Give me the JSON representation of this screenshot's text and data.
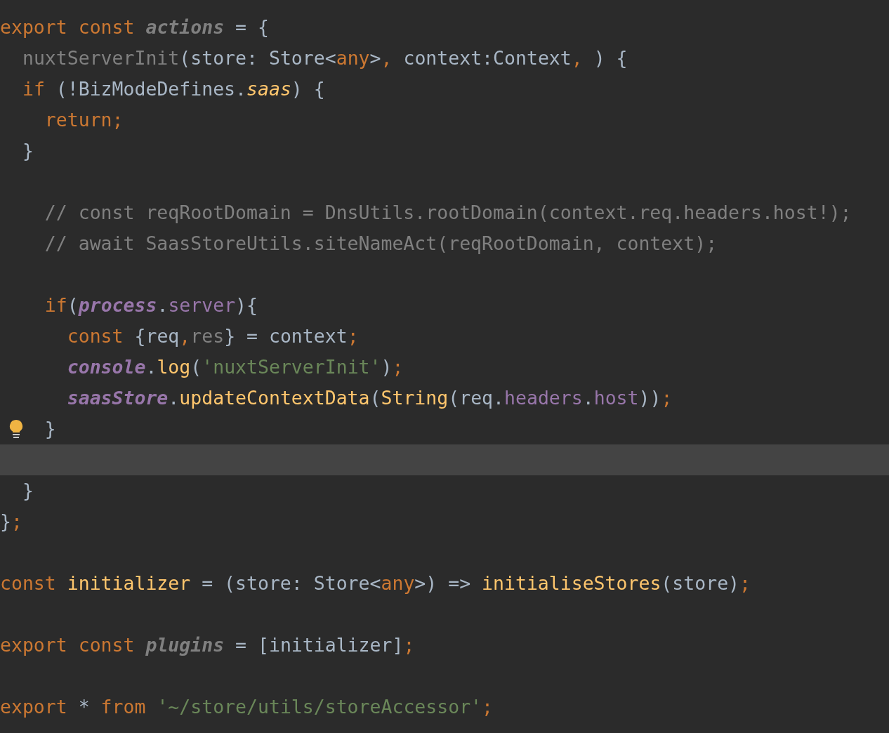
{
  "editor": {
    "lines": [
      {
        "selected": false,
        "tokens": [
          {
            "text": "export const ",
            "kind": "keyword"
          },
          {
            "text": "actions",
            "kind": "unused_export"
          },
          {
            "text": " = {",
            "kind": "plain"
          }
        ]
      },
      {
        "selected": false,
        "tokens": [
          {
            "text": "  nuxtServerInit",
            "kind": "unused"
          },
          {
            "text": "(store: Store<",
            "kind": "plain"
          },
          {
            "text": "any",
            "kind": "keyword"
          },
          {
            "text": ">",
            "kind": "plain"
          },
          {
            "text": ", ",
            "kind": "keyword"
          },
          {
            "text": "context:Context",
            "kind": "plain"
          },
          {
            "text": ", ",
            "kind": "keyword"
          },
          {
            "text": ") {",
            "kind": "plain"
          }
        ]
      },
      {
        "selected": false,
        "tokens": [
          {
            "text": "  if ",
            "kind": "keyword"
          },
          {
            "text": "(!BizModeDefines.",
            "kind": "plain"
          },
          {
            "text": "saas",
            "kind": "static"
          },
          {
            "text": ") {",
            "kind": "plain"
          }
        ]
      },
      {
        "selected": false,
        "tokens": [
          {
            "text": "    return;",
            "kind": "keyword"
          }
        ]
      },
      {
        "selected": false,
        "tokens": [
          {
            "text": "  }",
            "kind": "plain"
          }
        ]
      },
      {
        "selected": false
      },
      {
        "selected": false,
        "tokens": [
          {
            "text": "    // const reqRootDomain = DnsUtils.rootDomain(context.req.headers.host!);",
            "kind": "comment"
          }
        ]
      },
      {
        "selected": false,
        "tokens": [
          {
            "text": "    // await SaasStoreUtils.siteNameAct(reqRootDomain, context);",
            "kind": "comment"
          }
        ]
      },
      {
        "selected": false
      },
      {
        "selected": false,
        "tokens": [
          {
            "text": "    if",
            "kind": "keyword"
          },
          {
            "text": "(",
            "kind": "plain"
          },
          {
            "text": "process",
            "kind": "global"
          },
          {
            "text": ".",
            "kind": "plain"
          },
          {
            "text": "server",
            "kind": "field"
          },
          {
            "text": "){",
            "kind": "plain"
          }
        ]
      },
      {
        "selected": false,
        "tokens": [
          {
            "text": "      const ",
            "kind": "keyword"
          },
          {
            "text": "{req",
            "kind": "plain"
          },
          {
            "text": ",",
            "kind": "keyword"
          },
          {
            "text": "res",
            "kind": "unused"
          },
          {
            "text": "} = context",
            "kind": "plain"
          },
          {
            "text": ";",
            "kind": "keyword"
          }
        ]
      },
      {
        "selected": false,
        "tokens": [
          {
            "text": "      console",
            "kind": "global"
          },
          {
            "text": ".",
            "kind": "plain"
          },
          {
            "text": "log",
            "kind": "method"
          },
          {
            "text": "(",
            "kind": "plain"
          },
          {
            "text": "'nuxtServerInit'",
            "kind": "string"
          },
          {
            "text": ")",
            "kind": "plain"
          },
          {
            "text": ";",
            "kind": "keyword"
          }
        ]
      },
      {
        "selected": false,
        "tokens": [
          {
            "text": "      saasStore",
            "kind": "global"
          },
          {
            "text": ".",
            "kind": "plain"
          },
          {
            "text": "updateContextData",
            "kind": "method"
          },
          {
            "text": "(",
            "kind": "plain"
          },
          {
            "text": "String",
            "kind": "method"
          },
          {
            "text": "(req.",
            "kind": "plain"
          },
          {
            "text": "headers",
            "kind": "field"
          },
          {
            "text": ".",
            "kind": "plain"
          },
          {
            "text": "host",
            "kind": "field"
          },
          {
            "text": "))",
            "kind": "plain"
          },
          {
            "text": ";",
            "kind": "keyword"
          }
        ]
      },
      {
        "selected": false,
        "bulb": true,
        "tokens": [
          {
            "text": "    }",
            "kind": "plain"
          }
        ]
      },
      {
        "selected": true
      },
      {
        "selected": false,
        "tokens": [
          {
            "text": "  }",
            "kind": "plain"
          }
        ]
      },
      {
        "selected": false,
        "tokens": [
          {
            "text": "}",
            "kind": "plain"
          },
          {
            "text": ";",
            "kind": "keyword"
          }
        ]
      },
      {
        "selected": false
      },
      {
        "selected": false,
        "tokens": [
          {
            "text": "const ",
            "kind": "keyword"
          },
          {
            "text": "initializer",
            "kind": "method"
          },
          {
            "text": " = (store: Store<",
            "kind": "plain"
          },
          {
            "text": "any",
            "kind": "keyword"
          },
          {
            "text": ">) => ",
            "kind": "plain"
          },
          {
            "text": "initialiseStores",
            "kind": "method"
          },
          {
            "text": "(store)",
            "kind": "plain"
          },
          {
            "text": ";",
            "kind": "keyword"
          }
        ]
      },
      {
        "selected": false
      },
      {
        "selected": false,
        "tokens": [
          {
            "text": "export const ",
            "kind": "keyword"
          },
          {
            "text": "plugins",
            "kind": "unused_export"
          },
          {
            "text": " = [initializer]",
            "kind": "plain"
          },
          {
            "text": ";",
            "kind": "keyword"
          }
        ]
      },
      {
        "selected": false
      },
      {
        "selected": false,
        "tokens": [
          {
            "text": "export ",
            "kind": "keyword"
          },
          {
            "text": "* ",
            "kind": "plain"
          },
          {
            "text": "from ",
            "kind": "keyword"
          },
          {
            "text": "'~/store/utils/storeAccessor'",
            "kind": "string"
          },
          {
            "text": ";",
            "kind": "keyword"
          }
        ]
      }
    ]
  }
}
